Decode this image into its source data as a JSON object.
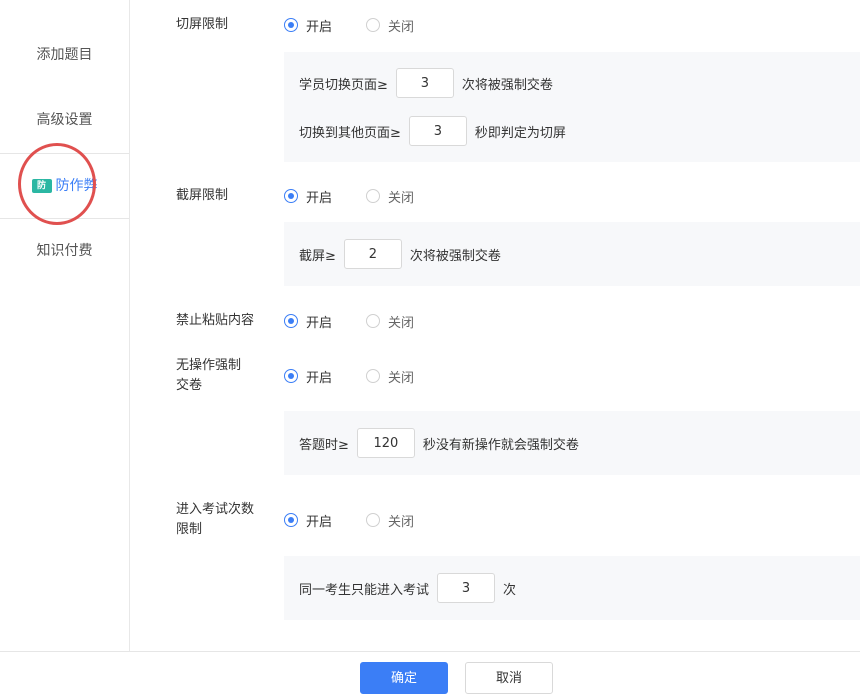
{
  "sidebar": {
    "items": [
      {
        "label": "添加题目"
      },
      {
        "label": "高级设置"
      },
      {
        "label": "防作弊",
        "icon": "anti-cheat-icon",
        "icon_text": "防"
      },
      {
        "label": "知识付费"
      }
    ]
  },
  "settings": {
    "switch_screen": {
      "label": "切屏限制",
      "options": [
        "开启",
        "关闭"
      ],
      "selected": "开启",
      "rows": [
        {
          "prefix": "学员切换页面≥",
          "value": "3",
          "suffix": "次将被强制交卷"
        },
        {
          "prefix": "切换到其他页面≥",
          "value": "3",
          "suffix": "秒即判定为切屏"
        }
      ]
    },
    "screenshot": {
      "label": "截屏限制",
      "options": [
        "开启",
        "关闭"
      ],
      "selected": "开启",
      "rows": [
        {
          "prefix": "截屏≥",
          "value": "2",
          "suffix": "次将被强制交卷"
        }
      ]
    },
    "no_paste": {
      "label": "禁止粘贴内容",
      "options": [
        "开启",
        "关闭"
      ],
      "selected": "开启"
    },
    "idle_submit": {
      "label_line1": "无操作强制",
      "label_line2": "交卷",
      "options": [
        "开启",
        "关闭"
      ],
      "selected": "开启",
      "rows": [
        {
          "prefix": "答题时≥",
          "value": "120",
          "suffix": "秒没有新操作就会强制交卷"
        }
      ]
    },
    "entry_limit": {
      "label_line1": "进入考试次数",
      "label_line2": "限制",
      "options": [
        "开启",
        "关闭"
      ],
      "selected": "开启",
      "rows": [
        {
          "prefix": "同一考生只能进入考试",
          "value": "3",
          "suffix": "次"
        }
      ]
    }
  },
  "footer": {
    "confirm_label": "确定",
    "cancel_label": "取消"
  },
  "colors": {
    "accent": "#3b7ef6",
    "annotation": "#e0504f",
    "icon_bg": "#2bb7a3"
  }
}
